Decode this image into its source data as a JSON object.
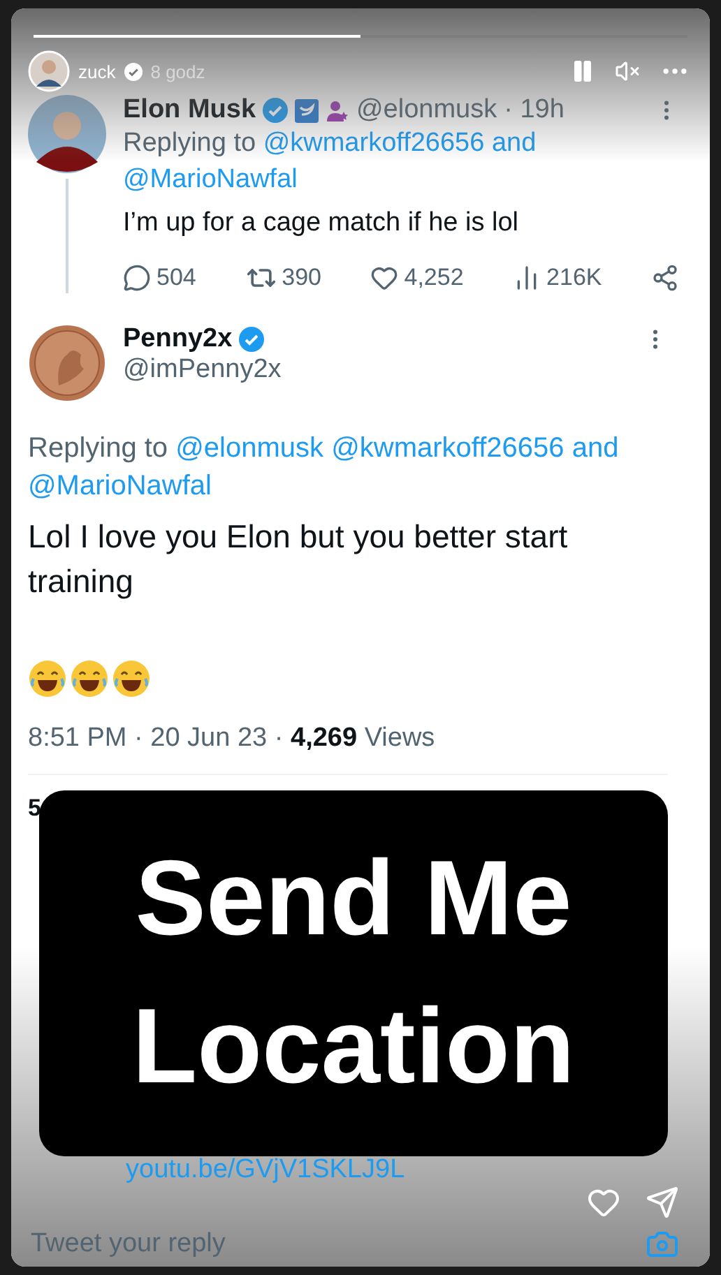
{
  "story": {
    "progress": {
      "level": 0.5
    },
    "user": "zuck",
    "time": "8 godz"
  },
  "tweet": {
    "name": "Elon Musk",
    "handle": "@elonmusk",
    "time": "· 19h",
    "replying_label": "Replying to",
    "replying_to": [
      "@kwmarkoff26656 and",
      "@MarioNawfal"
    ],
    "text": "I’m up for a cage match if he is lol",
    "stats": [
      {
        "kind": "replies",
        "value": "504"
      },
      {
        "kind": "retweets",
        "value": "390"
      },
      {
        "kind": "likes",
        "value": "4,252"
      },
      {
        "kind": "views",
        "value": "216K"
      }
    ]
  },
  "reply": {
    "name": "Penny2x",
    "handle": "@imPenny2x",
    "replying_label": "Replying to",
    "replying_to": [
      "@elonmusk",
      "@kwmarkoff26656 and",
      "@MarioNawfal"
    ],
    "text": "Lol I love you Elon but you better start training",
    "time": "8:51 PM · 20 Jun 23 · ",
    "views_count": "4,269",
    "views_label": " Views"
  },
  "stats_fragment": "5",
  "link_fragment": "youtu.be/GVjV1SKLJ9L",
  "sticker": {
    "lines": [
      "Send Me",
      "Location"
    ]
  },
  "reply_field": {
    "placeholder": "Tweet your reply"
  }
}
